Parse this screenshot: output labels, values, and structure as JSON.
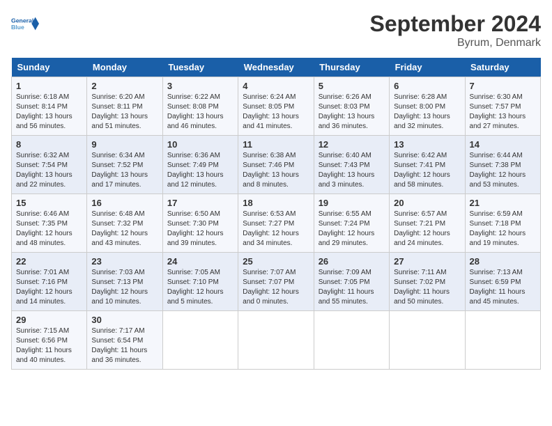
{
  "header": {
    "logo_line1": "General",
    "logo_line2": "Blue",
    "title": "September 2024",
    "subtitle": "Byrum, Denmark"
  },
  "days_of_week": [
    "Sunday",
    "Monday",
    "Tuesday",
    "Wednesday",
    "Thursday",
    "Friday",
    "Saturday"
  ],
  "weeks": [
    [
      {
        "num": "1",
        "info": "Sunrise: 6:18 AM\nSunset: 8:14 PM\nDaylight: 13 hours\nand 56 minutes."
      },
      {
        "num": "2",
        "info": "Sunrise: 6:20 AM\nSunset: 8:11 PM\nDaylight: 13 hours\nand 51 minutes."
      },
      {
        "num": "3",
        "info": "Sunrise: 6:22 AM\nSunset: 8:08 PM\nDaylight: 13 hours\nand 46 minutes."
      },
      {
        "num": "4",
        "info": "Sunrise: 6:24 AM\nSunset: 8:05 PM\nDaylight: 13 hours\nand 41 minutes."
      },
      {
        "num": "5",
        "info": "Sunrise: 6:26 AM\nSunset: 8:03 PM\nDaylight: 13 hours\nand 36 minutes."
      },
      {
        "num": "6",
        "info": "Sunrise: 6:28 AM\nSunset: 8:00 PM\nDaylight: 13 hours\nand 32 minutes."
      },
      {
        "num": "7",
        "info": "Sunrise: 6:30 AM\nSunset: 7:57 PM\nDaylight: 13 hours\nand 27 minutes."
      }
    ],
    [
      {
        "num": "8",
        "info": "Sunrise: 6:32 AM\nSunset: 7:54 PM\nDaylight: 13 hours\nand 22 minutes."
      },
      {
        "num": "9",
        "info": "Sunrise: 6:34 AM\nSunset: 7:52 PM\nDaylight: 13 hours\nand 17 minutes."
      },
      {
        "num": "10",
        "info": "Sunrise: 6:36 AM\nSunset: 7:49 PM\nDaylight: 13 hours\nand 12 minutes."
      },
      {
        "num": "11",
        "info": "Sunrise: 6:38 AM\nSunset: 7:46 PM\nDaylight: 13 hours\nand 8 minutes."
      },
      {
        "num": "12",
        "info": "Sunrise: 6:40 AM\nSunset: 7:43 PM\nDaylight: 13 hours\nand 3 minutes."
      },
      {
        "num": "13",
        "info": "Sunrise: 6:42 AM\nSunset: 7:41 PM\nDaylight: 12 hours\nand 58 minutes."
      },
      {
        "num": "14",
        "info": "Sunrise: 6:44 AM\nSunset: 7:38 PM\nDaylight: 12 hours\nand 53 minutes."
      }
    ],
    [
      {
        "num": "15",
        "info": "Sunrise: 6:46 AM\nSunset: 7:35 PM\nDaylight: 12 hours\nand 48 minutes."
      },
      {
        "num": "16",
        "info": "Sunrise: 6:48 AM\nSunset: 7:32 PM\nDaylight: 12 hours\nand 43 minutes."
      },
      {
        "num": "17",
        "info": "Sunrise: 6:50 AM\nSunset: 7:30 PM\nDaylight: 12 hours\nand 39 minutes."
      },
      {
        "num": "18",
        "info": "Sunrise: 6:53 AM\nSunset: 7:27 PM\nDaylight: 12 hours\nand 34 minutes."
      },
      {
        "num": "19",
        "info": "Sunrise: 6:55 AM\nSunset: 7:24 PM\nDaylight: 12 hours\nand 29 minutes."
      },
      {
        "num": "20",
        "info": "Sunrise: 6:57 AM\nSunset: 7:21 PM\nDaylight: 12 hours\nand 24 minutes."
      },
      {
        "num": "21",
        "info": "Sunrise: 6:59 AM\nSunset: 7:18 PM\nDaylight: 12 hours\nand 19 minutes."
      }
    ],
    [
      {
        "num": "22",
        "info": "Sunrise: 7:01 AM\nSunset: 7:16 PM\nDaylight: 12 hours\nand 14 minutes."
      },
      {
        "num": "23",
        "info": "Sunrise: 7:03 AM\nSunset: 7:13 PM\nDaylight: 12 hours\nand 10 minutes."
      },
      {
        "num": "24",
        "info": "Sunrise: 7:05 AM\nSunset: 7:10 PM\nDaylight: 12 hours\nand 5 minutes."
      },
      {
        "num": "25",
        "info": "Sunrise: 7:07 AM\nSunset: 7:07 PM\nDaylight: 12 hours\nand 0 minutes."
      },
      {
        "num": "26",
        "info": "Sunrise: 7:09 AM\nSunset: 7:05 PM\nDaylight: 11 hours\nand 55 minutes."
      },
      {
        "num": "27",
        "info": "Sunrise: 7:11 AM\nSunset: 7:02 PM\nDaylight: 11 hours\nand 50 minutes."
      },
      {
        "num": "28",
        "info": "Sunrise: 7:13 AM\nSunset: 6:59 PM\nDaylight: 11 hours\nand 45 minutes."
      }
    ],
    [
      {
        "num": "29",
        "info": "Sunrise: 7:15 AM\nSunset: 6:56 PM\nDaylight: 11 hours\nand 40 minutes."
      },
      {
        "num": "30",
        "info": "Sunrise: 7:17 AM\nSunset: 6:54 PM\nDaylight: 11 hours\nand 36 minutes."
      },
      null,
      null,
      null,
      null,
      null
    ]
  ]
}
